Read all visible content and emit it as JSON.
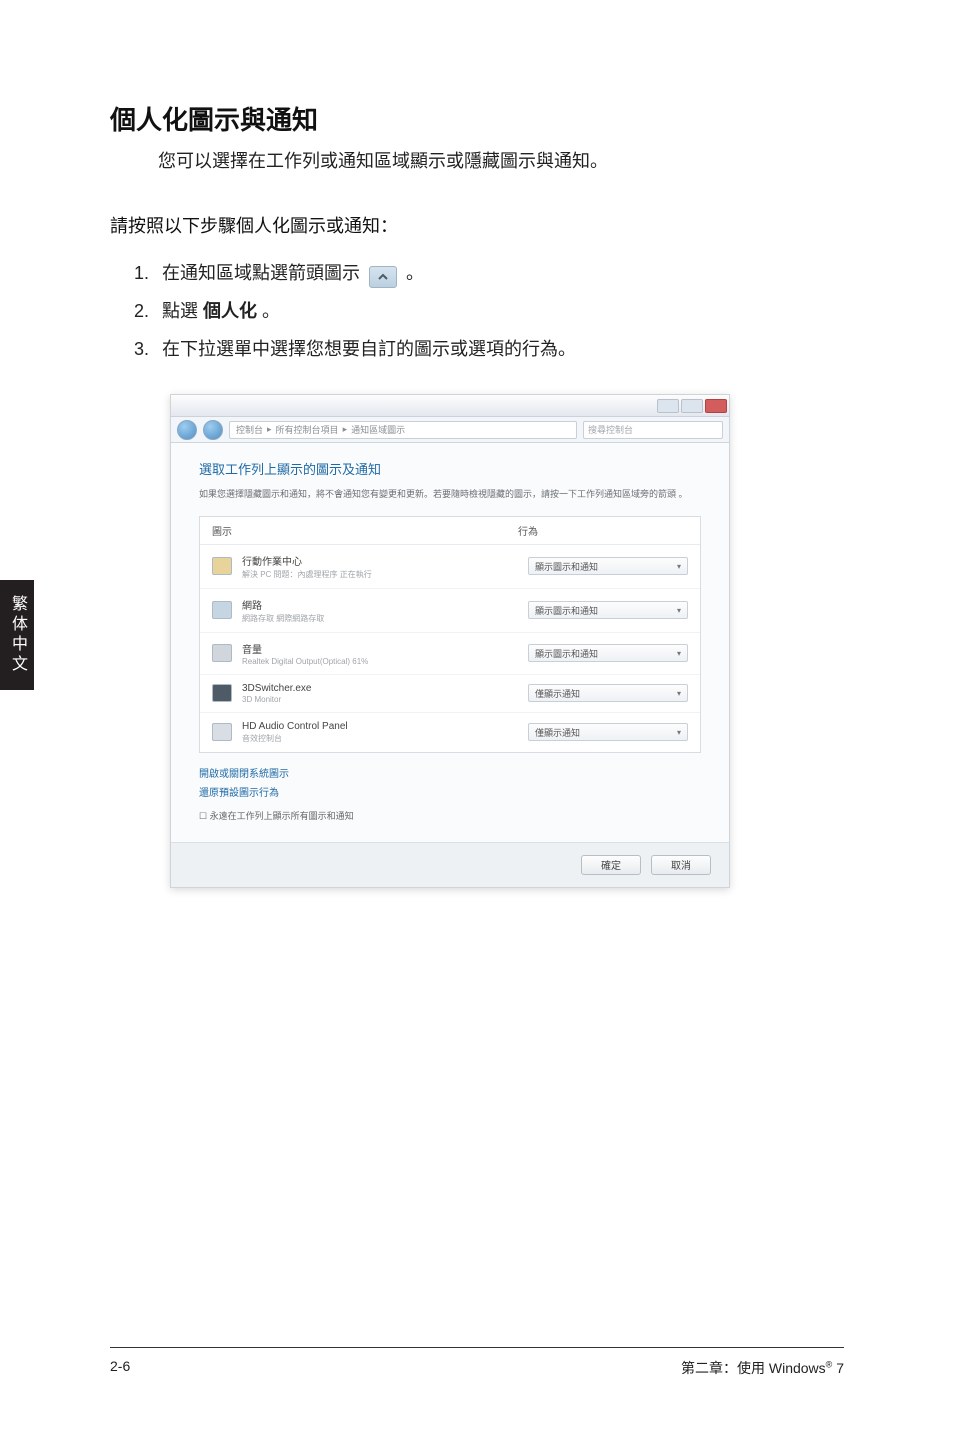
{
  "side_tab": "繁体中文",
  "title": "個人化圖示與通知",
  "intro": "您可以選擇在工作列或通知區域顯示或隱藏圖示與通知。",
  "subhead": "請按照以下步驟個人化圖示或通知：",
  "steps": {
    "s1_a": "在通知區域點選箭頭圖示",
    "s1_b": "。",
    "s2_a": "點選 ",
    "s2_b": "個人化",
    "s2_c": " 。",
    "s3": "在下拉選單中選擇您想要自訂的圖示或選項的行為。"
  },
  "screenshot": {
    "breadcrumb_parts": [
      "控制台",
      "所有控制台項目",
      "通知區域圖示"
    ],
    "search_placeholder": "搜尋控制台",
    "window_heading": "選取工作列上顯示的圖示及通知",
    "window_desc": "如果您選擇隱藏圖示和通知，將不會通知您有變更和更新。若要隨時檢視隱藏的圖示，請按一下工作列通知區域旁的箭頭 。",
    "col_icon": "圖示",
    "col_behavior": "行為",
    "rows": [
      {
        "name": "行動作業中心",
        "detail": "解決 PC 問題：內處理程序 正在執行",
        "behavior": "顯示圖示和通知"
      },
      {
        "name": "網路",
        "detail": "網路存取 網際網路存取",
        "behavior": "顯示圖示和通知"
      },
      {
        "name": "音量",
        "detail": "Realtek Digital Output(Optical) 61%",
        "behavior": "顯示圖示和通知"
      },
      {
        "name": "3DSwitcher.exe",
        "detail": "3D Monitor",
        "behavior": "僅顯示通知"
      },
      {
        "name": "HD Audio Control Panel",
        "detail": "音效控制台",
        "behavior": "僅顯示通知"
      }
    ],
    "link1": "開啟或關閉系統圖示",
    "link2": "還原預設圖示行為",
    "checkbox_label": "永遠在工作列上顯示所有圖示和通知",
    "btn_ok": "確定",
    "btn_cancel": "取消"
  },
  "footer": {
    "left": "2-6",
    "right_a": "第二章：使用 Windows",
    "right_sup": "®",
    "right_b": " 7"
  }
}
